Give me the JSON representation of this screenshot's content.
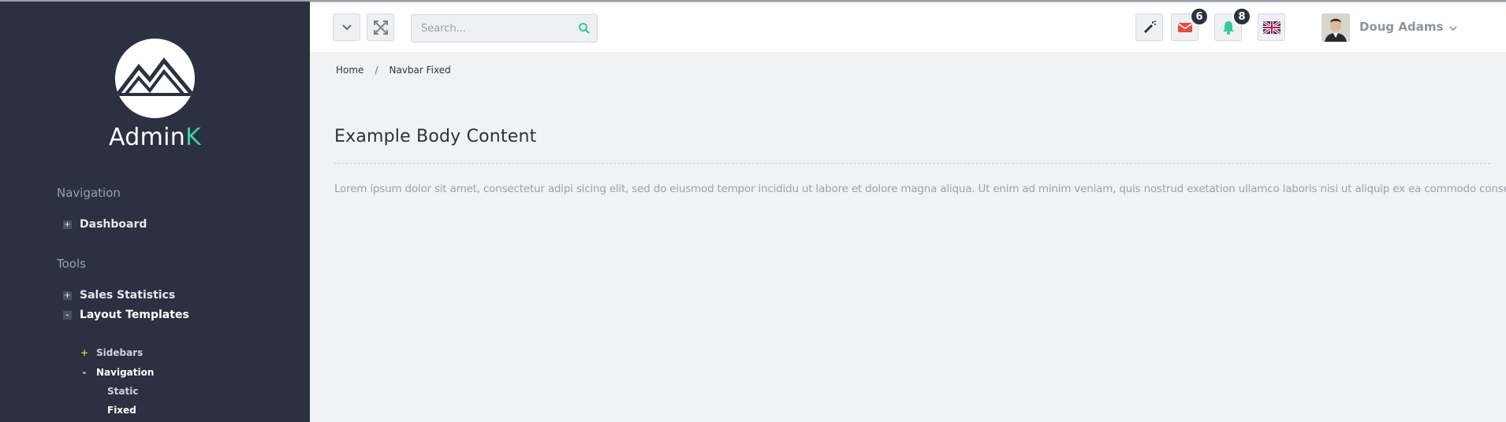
{
  "brand": {
    "name_main": "Admin",
    "name_accent": "K",
    "accent_color": "#3ecfa3"
  },
  "sidebar": {
    "sections": [
      {
        "title": "Navigation"
      },
      {
        "title": "Tools"
      }
    ],
    "items": [
      {
        "label": "Dashboard",
        "toggle": "+"
      },
      {
        "label": "Sales Statistics",
        "toggle": "+"
      },
      {
        "label": "Layout Templates",
        "toggle": "-"
      }
    ],
    "subitems": [
      {
        "label": "Sidebars",
        "marker": "+"
      },
      {
        "label": "Navigation",
        "marker": "-"
      }
    ],
    "subsubitems": [
      {
        "label": "Static"
      },
      {
        "label": "Fixed"
      }
    ]
  },
  "topbar": {
    "search_placeholder": "Search...",
    "mail_count": "6",
    "notification_count": "8",
    "user_name": "Doug Adams",
    "mail_color": "#e74c3c",
    "bell_color": "#2ecc9a"
  },
  "breadcrumb": {
    "home": "Home",
    "separator": "/",
    "current": "Navbar Fixed"
  },
  "content": {
    "title": "Example Body Content",
    "body": "Lorem ipsum dolor sit amet, consectetur adipi sicing elit, sed do eiusmod tempor incididu ut labore et dolore magna aliqua. Ut enim ad minim veniam, quis nostrud exetation ullamco laboris nisi ut aliquip ex ea commodo consequat."
  }
}
